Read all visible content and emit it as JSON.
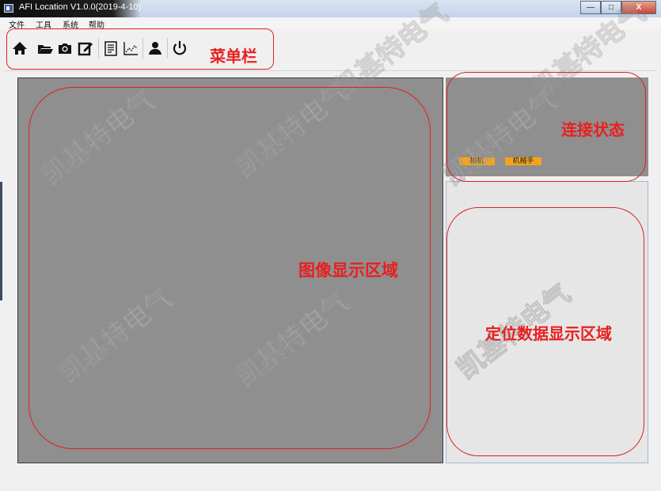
{
  "window": {
    "title": "AFI Location V1.0.0(2019-4-10)",
    "buttons": {
      "minimize": "—",
      "maximize": "□",
      "close": "X"
    }
  },
  "menu": {
    "items": [
      "文件",
      "工具",
      "系统",
      "帮助"
    ]
  },
  "toolbar": {
    "icons": [
      "home-icon",
      "folder-icon",
      "camera-icon",
      "edit-icon",
      "document-icon",
      "chart-icon",
      "user-icon",
      "power-icon"
    ]
  },
  "annotations": {
    "menubar": "菜单栏",
    "connection_status": "连接状态",
    "image_area": "图像显示区域",
    "position_data_area": "定位数据显示区域",
    "annotation_color": "#e02020"
  },
  "status": {
    "camera": "相机",
    "robot": "机械手",
    "indicator_color": "#f5a419"
  },
  "watermark": {
    "text": "凯基特电气"
  }
}
